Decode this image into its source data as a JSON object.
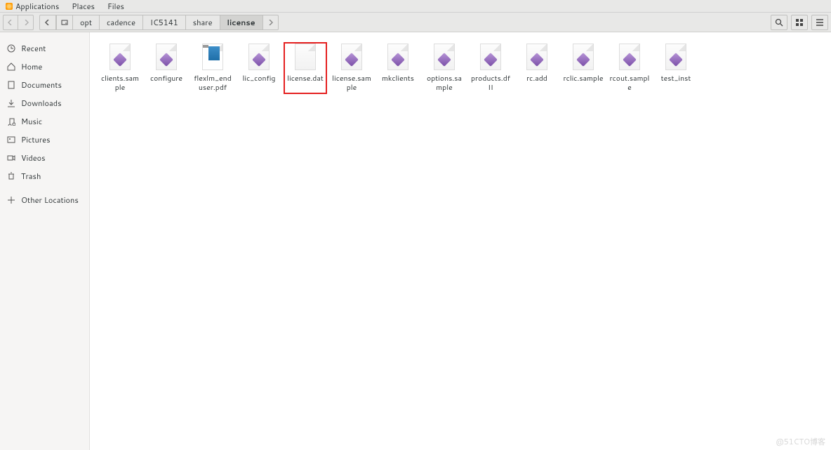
{
  "menubar": [
    "Applications",
    "Places",
    "Files"
  ],
  "breadcrumb": [
    "opt",
    "cadence",
    "IC5141",
    "share",
    "license"
  ],
  "breadcrumb_active_index": 4,
  "sidebar": [
    {
      "icon": "clock",
      "label": "Recent"
    },
    {
      "icon": "home",
      "label": "Home"
    },
    {
      "icon": "doc",
      "label": "Documents"
    },
    {
      "icon": "down",
      "label": "Downloads"
    },
    {
      "icon": "music",
      "label": "Music"
    },
    {
      "icon": "pic",
      "label": "Pictures"
    },
    {
      "icon": "vid",
      "label": "Videos"
    },
    {
      "icon": "trash",
      "label": "Trash"
    },
    {
      "icon": "plus",
      "label": "Other Locations"
    }
  ],
  "files": [
    {
      "name": "clients.sample",
      "type": "exec"
    },
    {
      "name": "configure",
      "type": "exec"
    },
    {
      "name": "flexlm_enduser.pdf",
      "type": "pdf"
    },
    {
      "name": "lic_config",
      "type": "exec"
    },
    {
      "name": "license.dat",
      "type": "text",
      "highlighted": true
    },
    {
      "name": "license.sample",
      "type": "exec"
    },
    {
      "name": "mkclients",
      "type": "exec"
    },
    {
      "name": "options.sample",
      "type": "exec"
    },
    {
      "name": "products.dfII",
      "type": "exec"
    },
    {
      "name": "rc.add",
      "type": "exec"
    },
    {
      "name": "rclic.sample",
      "type": "exec"
    },
    {
      "name": "rcout.sample",
      "type": "exec"
    },
    {
      "name": "test_inst",
      "type": "exec"
    }
  ],
  "watermark": "@51CTO博客"
}
